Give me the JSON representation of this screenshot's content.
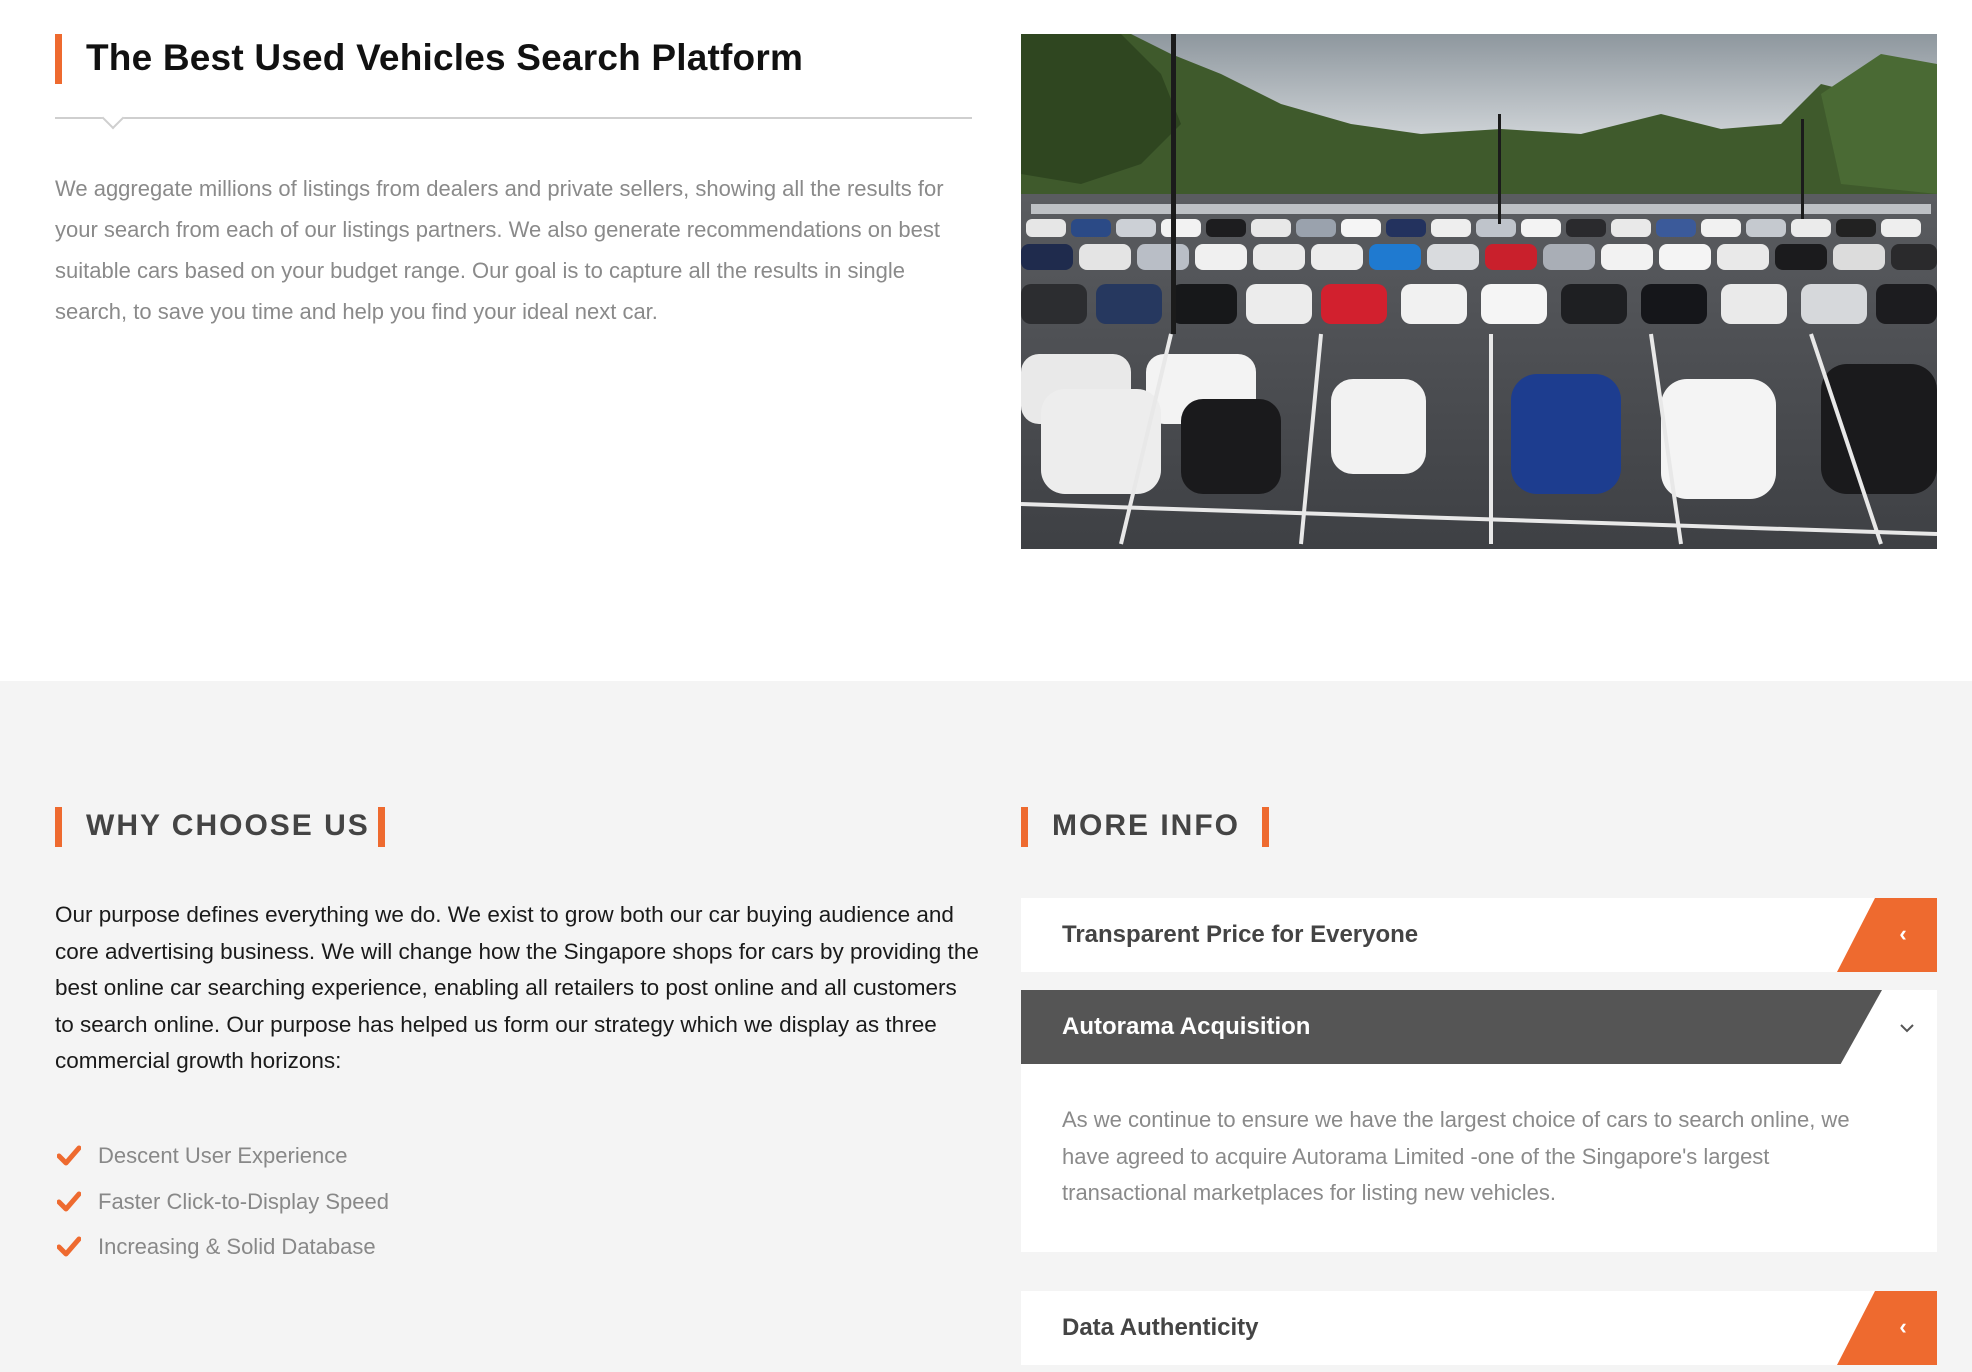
{
  "top": {
    "title": "The Best Used Vehicles Search Platform",
    "intro": "We aggregate millions of listings from dealers and private sellers, showing all the results for your search from each of our listings partners. We also generate recommendations on best suitable cars based on your budget range. Our goal is to capture all the results in single search, to save you time and help you find your ideal next car."
  },
  "why": {
    "heading": "WHY CHOOSE US",
    "text": "Our purpose defines everything we do. We exist to grow both our car buying audience and core advertising business. We will change how the Singapore shops for cars by providing the best online car searching experience, enabling all retailers to post online and all customers to search online. Our purpose has helped us form our strategy which we display as three commercial growth horizons:",
    "items": [
      "Descent User Experience",
      "Faster Click-to-Display Speed",
      "Increasing & Solid Database"
    ]
  },
  "more": {
    "heading": "MORE INFO",
    "accordion": [
      {
        "title": "Transparent Price for Everyone",
        "expanded": false
      },
      {
        "title": "Autorama Acquisition",
        "expanded": true,
        "body": "As we continue to ensure we have the largest choice of cars to search online, we have agreed to acquire Autorama Limited -one of the Singapore's largest transactional marketplaces for listing new vehicles."
      },
      {
        "title": "Data Authenticity",
        "expanded": false
      }
    ]
  },
  "colors": {
    "accent": "#ee6a2f",
    "dark_panel": "#555555",
    "section_bg": "#f4f4f4"
  },
  "icons": {
    "check": "check-icon",
    "collapsed": "chevron-left-icon",
    "expanded": "chevron-down-icon"
  }
}
